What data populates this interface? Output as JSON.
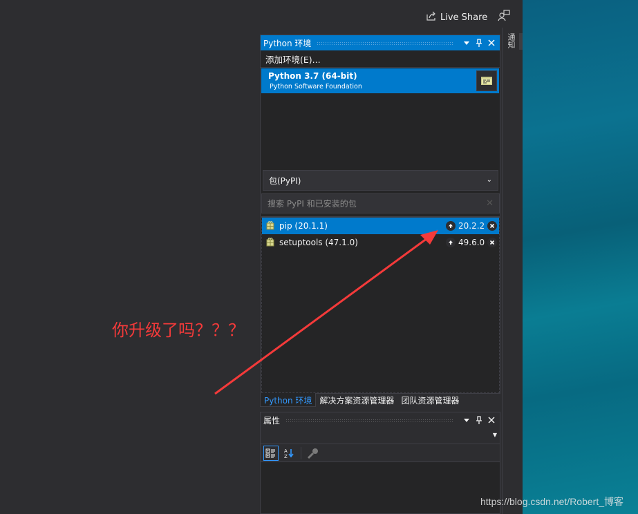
{
  "topbar": {
    "live_share_label": "Live Share",
    "live_share_icon": "share-icon",
    "feedback_icon": "feedback-person-icon"
  },
  "right_strip": {
    "vertical_tab_label": "通知"
  },
  "env_panel": {
    "title": "Python 环境",
    "add_env_label": "添加环境(E)...",
    "environment": {
      "name": "Python 3.7 (64-bit)",
      "vendor": "Python Software Foundation"
    },
    "package_source": "包(PyPI)",
    "search_placeholder": "搜索 PyPI 和已安装的包",
    "packages": [
      {
        "label": "pip (20.1.1)",
        "latest": "20.2.2",
        "selected": true
      },
      {
        "label": "setuptools (47.1.0)",
        "latest": "49.6.0",
        "selected": false
      }
    ]
  },
  "bottom_tabs": [
    {
      "label": "Python 环境",
      "active": true
    },
    {
      "label": "解决方案资源管理器",
      "active": false
    },
    {
      "label": "团队资源管理器",
      "active": false
    }
  ],
  "props_panel": {
    "title": "属性"
  },
  "annotation": {
    "text": "你升级了吗？？？",
    "color": "#f43a3a"
  },
  "watermark": "https://blog.csdn.net/Robert_博客",
  "colors": {
    "accent": "#007acc",
    "background": "#2d2d30",
    "panel": "#252526",
    "tab_active_text": "#3399ff"
  }
}
